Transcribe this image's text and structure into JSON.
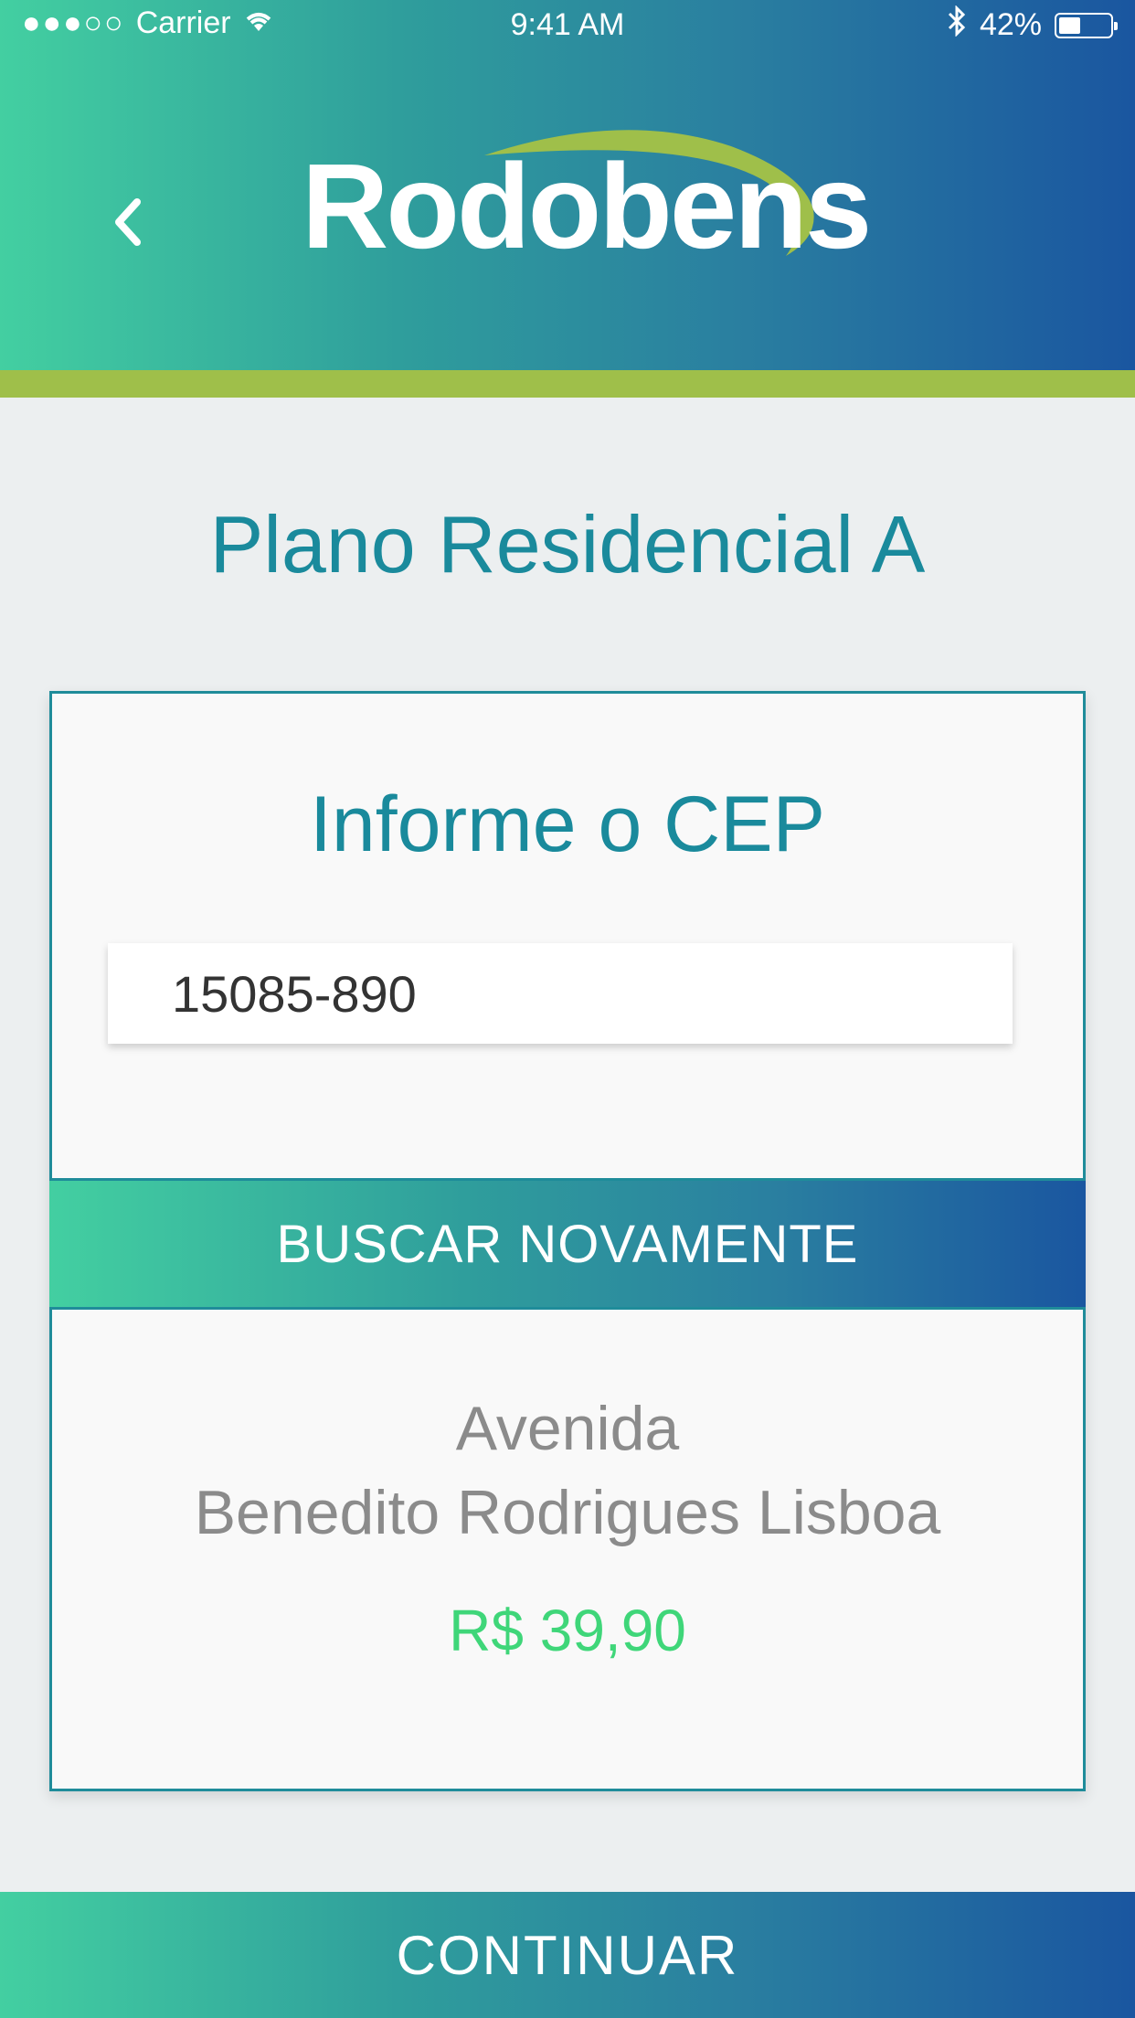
{
  "status_bar": {
    "signal": "●●●○○",
    "carrier": "Carrier",
    "time": "9:41 AM",
    "battery": "42%",
    "battery_level": 0.42
  },
  "header": {
    "logo_text": "Rodobens",
    "back_icon": "chevron-left-icon",
    "colors": {
      "gradient_start": "#43cfa1",
      "gradient_end": "#1a56a0",
      "accent": "#9fbf4a"
    }
  },
  "page": {
    "title": "Plano Residencial A"
  },
  "card": {
    "title": "Informe o CEP",
    "cep_value": "15085-890",
    "search_label": "BUSCAR NOVAMENTE",
    "address_line1": "Avenida",
    "address_line2": "Benedito Rodrigues Lisboa",
    "price": "R$ 39,90",
    "price_color": "#3fd679"
  },
  "footer": {
    "continue_label": "CONTINUAR"
  }
}
